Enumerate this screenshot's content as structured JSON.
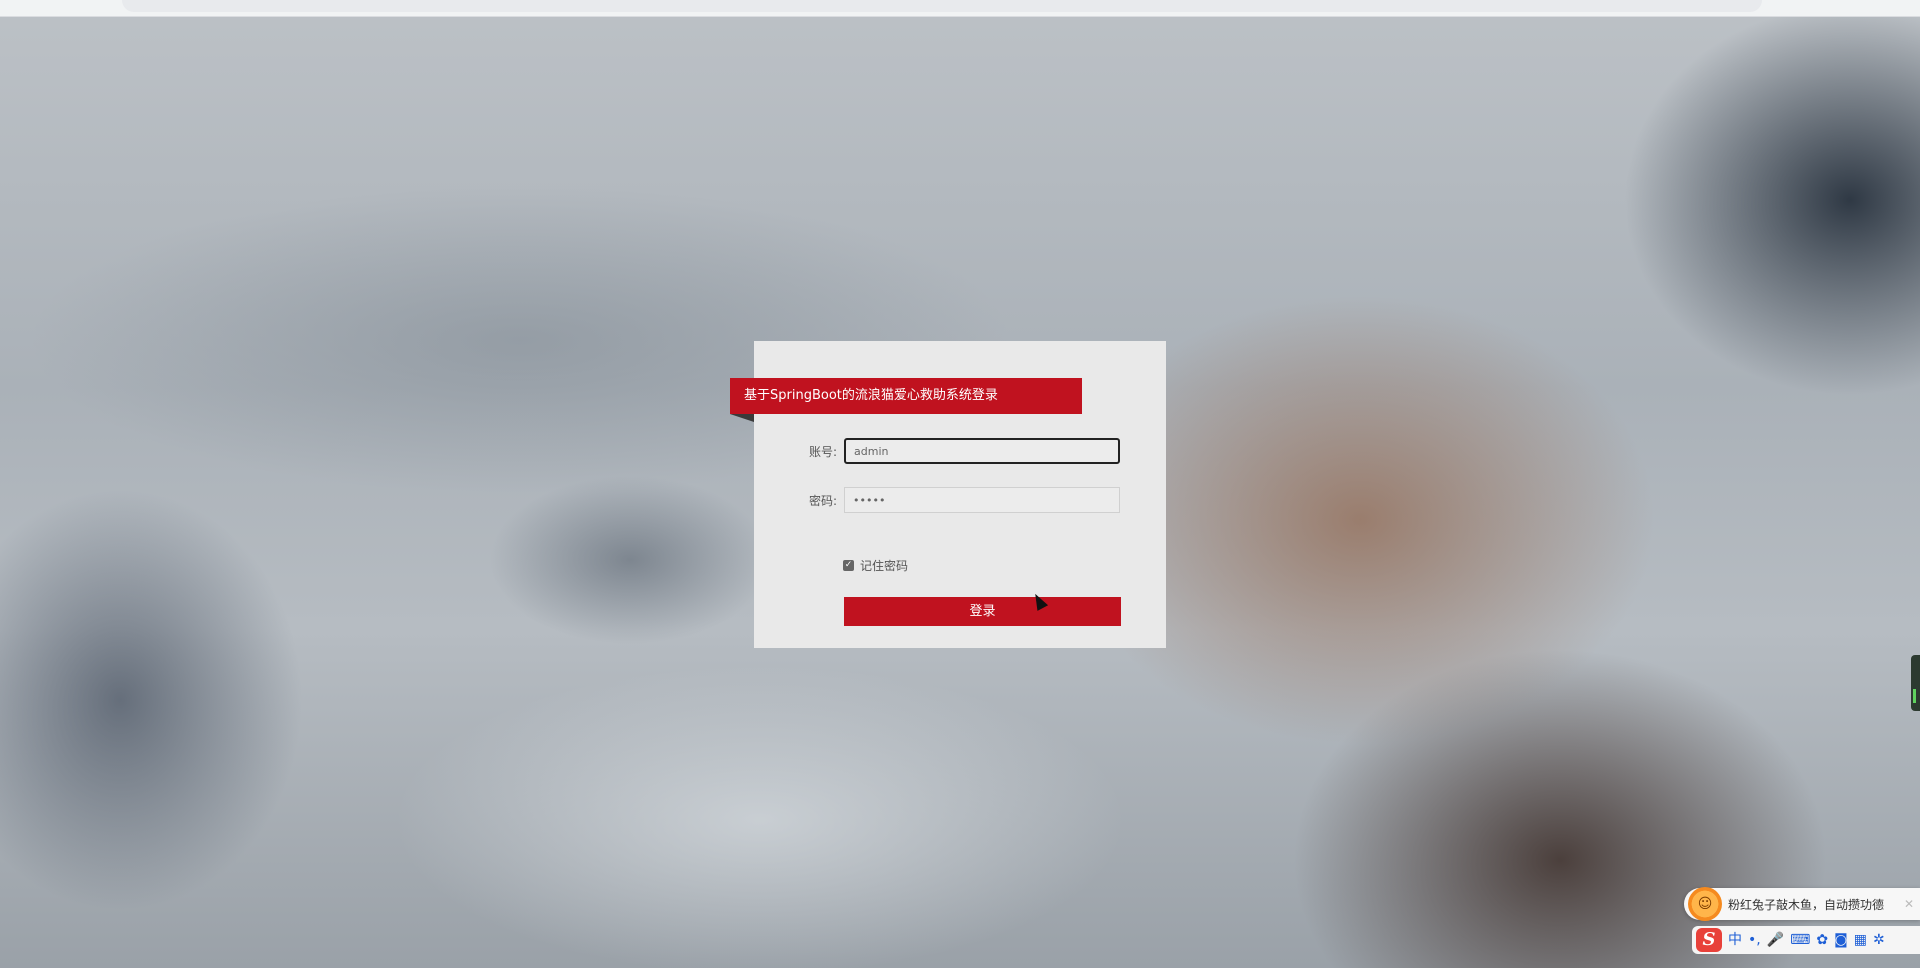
{
  "login": {
    "title": "基于SpringBoot的流浪猫爱心救助系统登录",
    "account_label": "账号:",
    "account_value": "admin",
    "password_label": "密码:",
    "password_value": "•••••",
    "remember_label": "记住密码",
    "remember_checked": true,
    "submit_label": "登录"
  },
  "ime": {
    "tip_text": "粉红兔子敲木鱼，自动攒功德",
    "toolbar_language": "中",
    "toolbar_punct": "•,"
  },
  "colors": {
    "accent": "#c0121f",
    "panel": "#e9e9e9"
  }
}
